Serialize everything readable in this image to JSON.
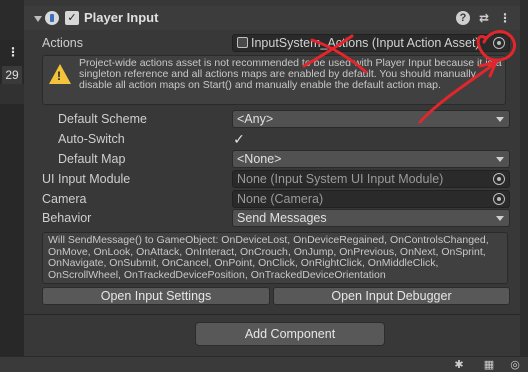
{
  "left_pane": {
    "frame_number": "29",
    "kebab": "⋮"
  },
  "header": {
    "title": "Player Input",
    "enabled_check": "✓",
    "help": "?",
    "presets": "⇄",
    "more": "⋮"
  },
  "actions": {
    "label": "Actions",
    "value": "InputSystem_Actions (Input Action Asset)"
  },
  "warning": {
    "text": "Project-wide actions asset is not recommended to be used with Player Input because it is a singleton reference and all actions maps are enabled by default. You should manually disable all action maps on Start() and manually enable the default action map."
  },
  "default_scheme": {
    "label": "Default Scheme",
    "value": "<Any>"
  },
  "auto_switch": {
    "label": "Auto-Switch",
    "checked": "✓"
  },
  "default_map": {
    "label": "Default Map",
    "value": "<None>"
  },
  "ui_input_module": {
    "label": "UI Input Module",
    "value": "None (Input System UI Input Module)"
  },
  "camera": {
    "label": "Camera",
    "value": "None (Camera)"
  },
  "behavior": {
    "label": "Behavior",
    "value": "Send Messages"
  },
  "info": {
    "text": "Will SendMessage() to GameObject: OnDeviceLost, OnDeviceRegained, OnControlsChanged, OnMove, OnLook, OnAttack, OnInteract, OnCrouch, OnJump, OnPrevious, OnNext, OnSprint, OnNavigate, OnSubmit, OnCancel, OnPoint, OnClick, OnRightClick, OnMiddleClick, OnScrollWheel, OnTrackedDevicePosition, OnTrackedDeviceOrientation"
  },
  "buttons": {
    "open_settings": "Open Input Settings",
    "open_debugger": "Open Input Debugger",
    "add_component": "Add Component"
  },
  "colors": {
    "annotation": "#e3262b",
    "warning": "#f2c43b",
    "panel": "#383838"
  },
  "icons": [
    "foldout-arrow-icon",
    "component-icon",
    "help-icon",
    "presets-icon",
    "kebab-icon",
    "object-picker-icon",
    "warning-icon",
    "checkmark-icon"
  ]
}
